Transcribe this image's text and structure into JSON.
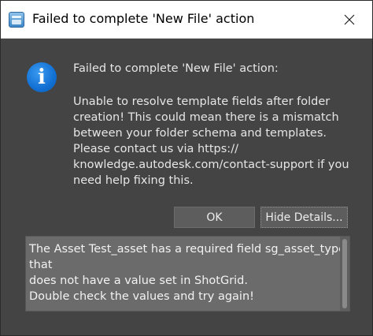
{
  "window": {
    "title": "Failed to complete 'New File' action"
  },
  "dialog": {
    "icon": "info-icon",
    "header": "Failed to complete 'New File' action:",
    "message_lines": [
      "Unable to resolve template fields after folder",
      "creation!  This could mean there is a mismatch",
      "between your folder schema and templates.",
      "Please contact us via https://",
      "knowledge.autodesk.com/contact-support if you",
      "need help fixing this."
    ],
    "buttons": {
      "ok": "OK",
      "details": "Hide Details..."
    },
    "details_lines": [
      "The Asset Test_asset has a required field sg_asset_type",
      "that",
      "does not have a value set in ShotGrid.",
      "Double check the values and try again!"
    ]
  },
  "colors": {
    "background": "#444444",
    "titlebar": "#ffffff",
    "info_icon": "#1170d3",
    "details_background": "#6b6b6b",
    "button": "#5d5d5d"
  }
}
